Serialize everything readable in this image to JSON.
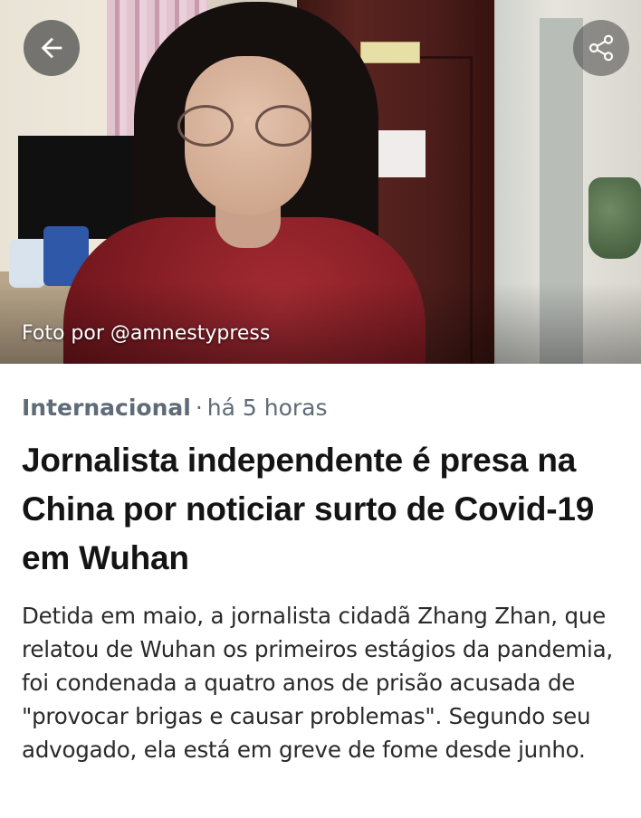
{
  "hero": {
    "photo_credit": "Foto por @amnestypress",
    "back_icon": "arrow-left-icon",
    "share_icon": "share-icon"
  },
  "article": {
    "section": "Internacional",
    "separator": "·",
    "time_ago": "há 5 horas",
    "headline": "Jornalista independente é presa na China por noticiar surto de Covid-19 em Wuhan",
    "summary": "Detida em maio, a jornalista cidadã Zhang Zhan, que relatou de Wuhan os primeiros estágios da pandemia, foi condenada a quatro anos de prisão acusada de \"provocar brigas e causar problemas\". Segundo seu advogado, ela está em greve de fome desde junho."
  },
  "colors": {
    "meta_text": "#5f6b77",
    "headline_text": "#141414",
    "body_text": "#2a2a2a"
  }
}
